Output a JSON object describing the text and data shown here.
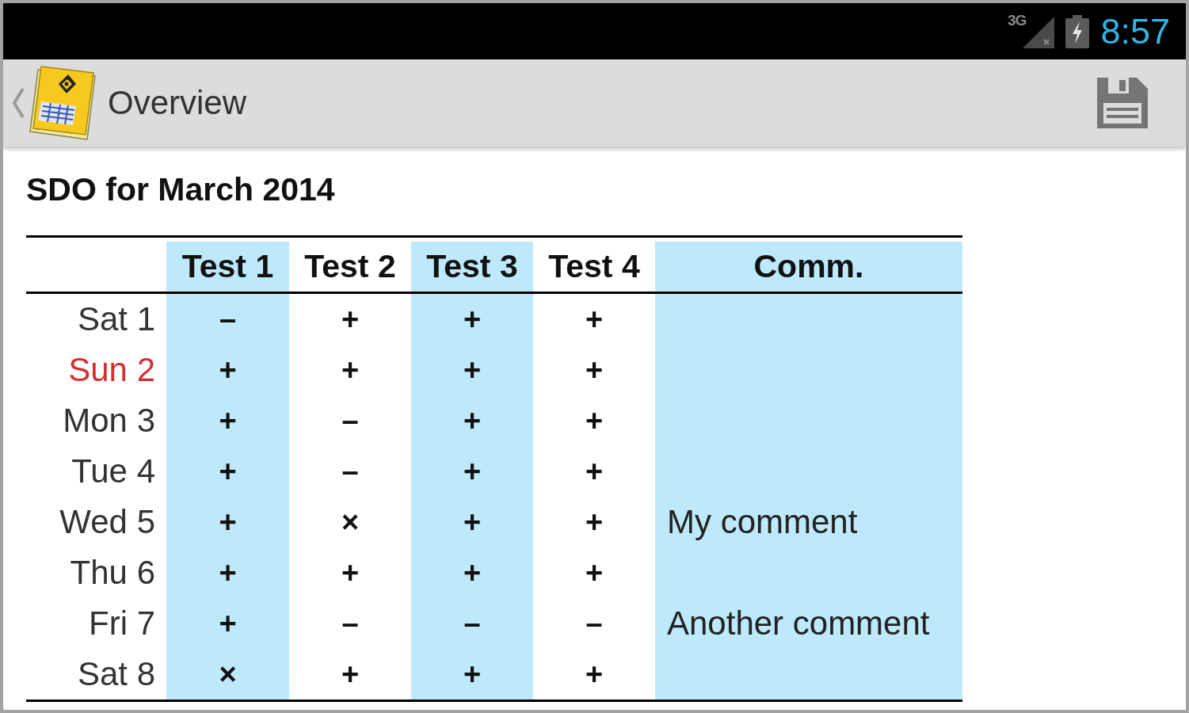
{
  "status_bar": {
    "network": "3G",
    "time": "8:57"
  },
  "action_bar": {
    "title": "Overview"
  },
  "heading": "SDO for March 2014",
  "table": {
    "columns": [
      "Test 1",
      "Test 2",
      "Test 3",
      "Test 4",
      "Comm."
    ],
    "rows": [
      {
        "day": "Sat 1",
        "color": "#333333",
        "marks": [
          "–",
          "+",
          "+",
          "+"
        ]
      },
      {
        "day": "Sun 2",
        "color": "#d32f2f",
        "marks": [
          "+",
          "+",
          "+",
          "+"
        ]
      },
      {
        "day": "Mon 3",
        "color": "#333333",
        "marks": [
          "+",
          "–",
          "+",
          "+"
        ]
      },
      {
        "day": "Tue 4",
        "color": "#333333",
        "marks": [
          "+",
          "–",
          "+",
          "+"
        ]
      },
      {
        "day": "Wed 5",
        "color": "#333333",
        "marks": [
          "+",
          "×",
          "+",
          "+"
        ],
        "comment": "My comment"
      },
      {
        "day": "Thu 6",
        "color": "#333333",
        "marks": [
          "+",
          "+",
          "+",
          "+"
        ]
      },
      {
        "day": "Fri 7",
        "color": "#333333",
        "marks": [
          "+",
          "–",
          "–",
          "–"
        ],
        "comment": "Another comment"
      },
      {
        "day": "Sat 8",
        "color": "#333333",
        "marks": [
          "×",
          "+",
          "+",
          "+"
        ]
      }
    ]
  }
}
